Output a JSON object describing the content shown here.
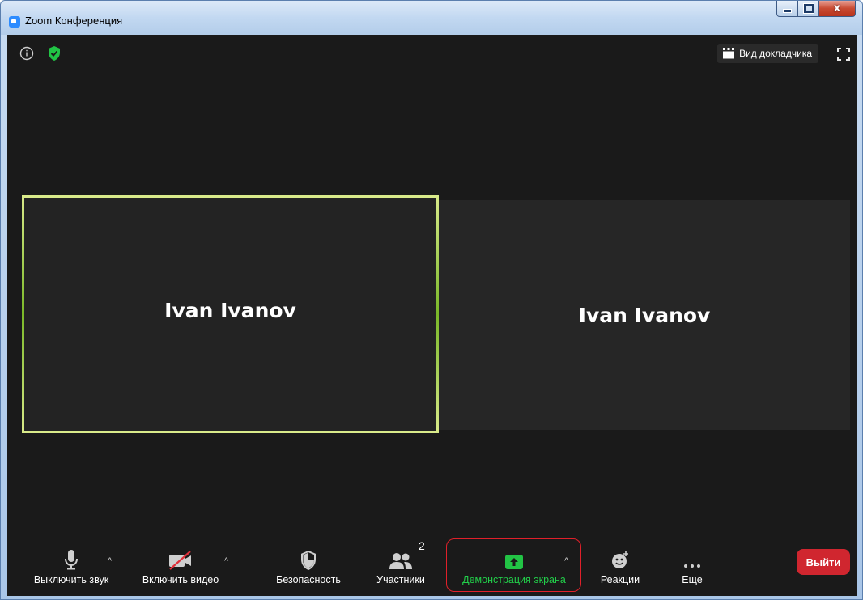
{
  "window": {
    "title": "Zoom Конференция",
    "close_glyph": "x"
  },
  "header": {
    "speaker_view_label": "Вид докладчика"
  },
  "tiles": [
    {
      "name": "Ivan Ivanov",
      "active": true
    },
    {
      "name": "Ivan Ivanov",
      "active": false
    }
  ],
  "toolbar": {
    "mute_label": "Выключить звук",
    "video_label": "Включить видео",
    "security_label": "Безопасность",
    "participants_label": "Участники",
    "participants_count": "2",
    "share_label": "Демонстрация экрана",
    "reactions_label": "Реакции",
    "more_label": "Еще",
    "leave_label": "Выйти",
    "caret": "^"
  },
  "colors": {
    "accent_green": "#22cf4a",
    "leave_red": "#d0262f",
    "highlight_red": "#e0202a",
    "active_border": "#d9ea8a"
  }
}
